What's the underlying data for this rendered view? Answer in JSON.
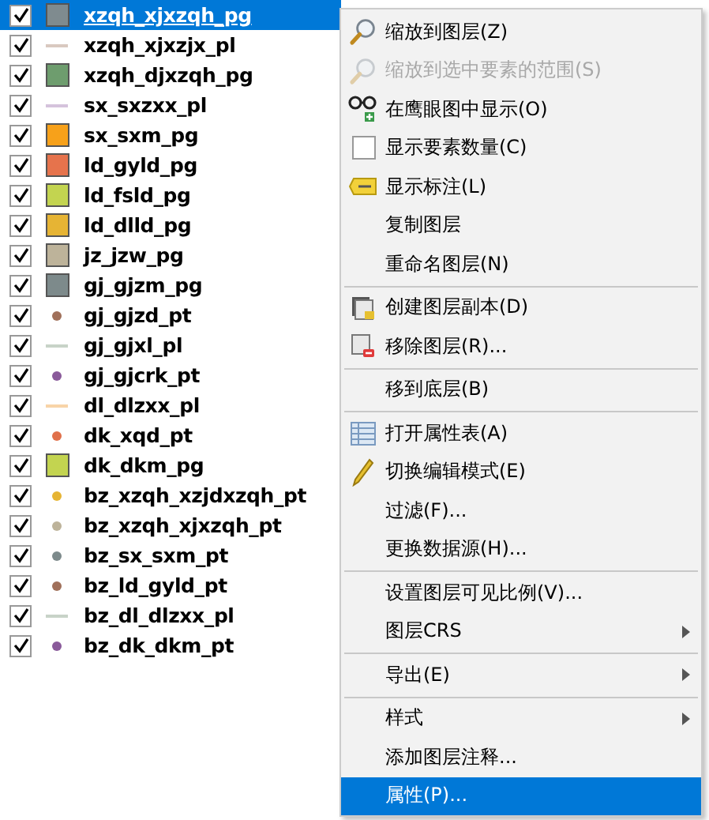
{
  "layers": [
    {
      "name": "xzqh_xjxzqh_pg",
      "checked": true,
      "selected": true,
      "kind": "fill",
      "color": "#7f8b8f"
    },
    {
      "name": "xzqh_xjxzjx_pl",
      "checked": true,
      "selected": false,
      "kind": "line",
      "color": "#d9c9c0"
    },
    {
      "name": "xzqh_djxzqh_pg",
      "checked": true,
      "selected": false,
      "kind": "fill",
      "color": "#6e9d6e"
    },
    {
      "name": "sx_sxzxx_pl",
      "checked": true,
      "selected": false,
      "kind": "line",
      "color": "#d5c3dc"
    },
    {
      "name": "sx_sxm_pg",
      "checked": true,
      "selected": false,
      "kind": "fill",
      "color": "#f7a11a"
    },
    {
      "name": "ld_gyld_pg",
      "checked": true,
      "selected": false,
      "kind": "fill",
      "color": "#e6734c"
    },
    {
      "name": "ld_fsld_pg",
      "checked": true,
      "selected": false,
      "kind": "fill",
      "color": "#c3d450"
    },
    {
      "name": "ld_dlld_pg",
      "checked": true,
      "selected": false,
      "kind": "fill",
      "color": "#e6b434"
    },
    {
      "name": "jz_jzw_pg",
      "checked": true,
      "selected": false,
      "kind": "fill",
      "color": "#bdb39a"
    },
    {
      "name": "gj_gjzm_pg",
      "checked": true,
      "selected": false,
      "kind": "fill",
      "color": "#7d8a8b"
    },
    {
      "name": "gj_gjzd_pt",
      "checked": true,
      "selected": false,
      "kind": "point",
      "color": "#a0705a"
    },
    {
      "name": "gj_gjxl_pl",
      "checked": true,
      "selected": false,
      "kind": "line",
      "color": "#c8d3c8"
    },
    {
      "name": "gj_gjcrk_pt",
      "checked": true,
      "selected": false,
      "kind": "point",
      "color": "#8a5a9a"
    },
    {
      "name": "dl_dlzxx_pl",
      "checked": true,
      "selected": false,
      "kind": "line",
      "color": "#f8d4a8"
    },
    {
      "name": "dk_xqd_pt",
      "checked": true,
      "selected": false,
      "kind": "point",
      "color": "#e0704a"
    },
    {
      "name": "dk_dkm_pg",
      "checked": true,
      "selected": false,
      "kind": "fill",
      "color": "#c3d450"
    },
    {
      "name": "bz_xzqh_xzjdxzqh_pt",
      "checked": true,
      "selected": false,
      "kind": "point",
      "color": "#e6b434"
    },
    {
      "name": "bz_xzqh_xjxzqh_pt",
      "checked": true,
      "selected": false,
      "kind": "point",
      "color": "#bdb39a"
    },
    {
      "name": "bz_sx_sxm_pt",
      "checked": true,
      "selected": false,
      "kind": "point",
      "color": "#7d8a8b"
    },
    {
      "name": "bz_ld_gyld_pt",
      "checked": true,
      "selected": false,
      "kind": "point",
      "color": "#a0705a"
    },
    {
      "name": "bz_dl_dlzxx_pl",
      "checked": true,
      "selected": false,
      "kind": "line",
      "color": "#c8d3c8"
    },
    {
      "name": "bz_dk_dkm_pt",
      "checked": true,
      "selected": false,
      "kind": "point",
      "color": "#8a5a9a"
    }
  ],
  "context_menu": [
    {
      "kind": "zoom",
      "label": "缩放到图层(Z)",
      "disabled": false,
      "selected": false
    },
    {
      "kind": "zoom",
      "label": "缩放到选中要素的范围(S)",
      "disabled": true,
      "selected": false
    },
    {
      "kind": "overview",
      "label": "在鹰眼图中显示(O)",
      "disabled": false,
      "selected": false
    },
    {
      "kind": "check",
      "label": "显示要素数量(C)",
      "checked": false,
      "disabled": false,
      "selected": false
    },
    {
      "kind": "labels",
      "label": "显示标注(L)",
      "disabled": false,
      "selected": false
    },
    {
      "kind": "plain",
      "label": "复制图层",
      "disabled": false,
      "selected": false
    },
    {
      "kind": "plain",
      "label": "重命名图层(N)",
      "disabled": false,
      "selected": false
    },
    {
      "kind": "separator"
    },
    {
      "kind": "duplicate",
      "label": "创建图层副本(D)",
      "disabled": false,
      "selected": false
    },
    {
      "kind": "remove",
      "label": "移除图层(R)...",
      "disabled": false,
      "selected": false
    },
    {
      "kind": "separator"
    },
    {
      "kind": "plain",
      "label": "移到底层(B)",
      "disabled": false,
      "selected": false
    },
    {
      "kind": "separator"
    },
    {
      "kind": "table",
      "label": "打开属性表(A)",
      "disabled": false,
      "selected": false
    },
    {
      "kind": "edit",
      "label": "切换编辑模式(E)",
      "disabled": false,
      "selected": false
    },
    {
      "kind": "plain",
      "label": "过滤(F)...",
      "disabled": false,
      "selected": false
    },
    {
      "kind": "plain",
      "label": "更换数据源(H)...",
      "disabled": false,
      "selected": false
    },
    {
      "kind": "separator"
    },
    {
      "kind": "plain",
      "label": "设置图层可见比例(V)...",
      "disabled": false,
      "selected": false
    },
    {
      "kind": "submenu",
      "label": "图层CRS",
      "disabled": false,
      "selected": false
    },
    {
      "kind": "separator"
    },
    {
      "kind": "submenu",
      "label": "导出(E)",
      "disabled": false,
      "selected": false
    },
    {
      "kind": "separator"
    },
    {
      "kind": "submenu",
      "label": "样式",
      "disabled": false,
      "selected": false
    },
    {
      "kind": "plain",
      "label": "添加图层注释...",
      "disabled": false,
      "selected": false
    },
    {
      "kind": "plain",
      "label": "属性(P)...",
      "disabled": false,
      "selected": true
    }
  ]
}
